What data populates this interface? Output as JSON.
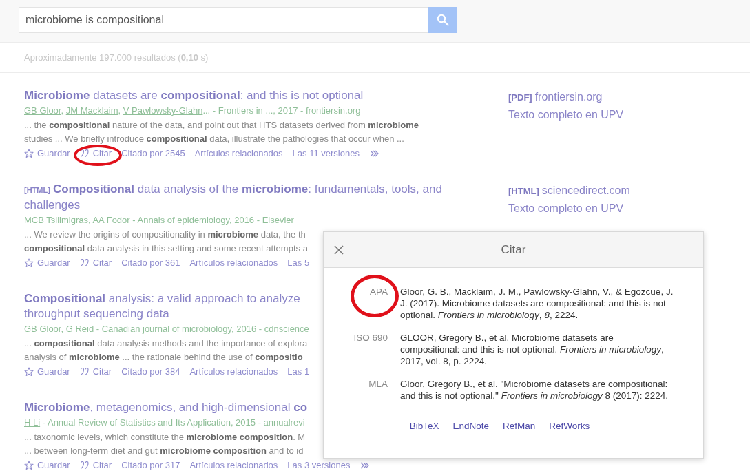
{
  "search": {
    "value": "microbiome is compositional"
  },
  "stats": "Aproximadamente 197.000 resultados (**0,10** s)",
  "results": [
    {
      "title_lines": [
        "**Microbiome** datasets are **compositional**: and this is not optional"
      ],
      "byline": [
        {
          "text": "GB Gloor",
          "link": true
        },
        {
          "text": ", ",
          "link": false
        },
        {
          "text": "JM Macklaim",
          "link": true
        },
        {
          "text": ", ",
          "link": false
        },
        {
          "text": "V Pawlowsky-Glahn",
          "link": true
        },
        {
          "text": "... - Frontiers in ..., 2017 - frontiersin.org",
          "link": false
        }
      ],
      "snippet_lines": [
        "... the **compositional** nature of the data, and point out that HTS datasets derived from **microbiome**",
        "studies ... We briefly introduce **compositional** data, illustrate the pathologies that occur when ..."
      ],
      "actions": [
        {
          "kind": "save",
          "label": "Guardar",
          "highlighted": false
        },
        {
          "kind": "cite",
          "label": "Citar",
          "highlighted": true
        },
        {
          "kind": "link",
          "label": "Citado por 2545",
          "highlighted": false
        },
        {
          "kind": "link",
          "label": "Artículos relacionados",
          "highlighted": false
        },
        {
          "kind": "link",
          "label": "Las 11 versiones",
          "highlighted": false
        },
        {
          "kind": "more",
          "highlighted": false
        }
      ],
      "side": [
        {
          "tag": "[PDF]",
          "text": "frontiersin.org"
        },
        {
          "text": "Texto completo en UPV"
        }
      ]
    },
    {
      "tag": "[HTML]",
      "title_lines": [
        "**Compositional** data analysis of the **microbiome**: fundamentals, tools, and",
        "challenges"
      ],
      "byline": [
        {
          "text": "MCB Tsilimigras",
          "link": true
        },
        {
          "text": ", ",
          "link": false
        },
        {
          "text": "AA Fodor",
          "link": true
        },
        {
          "text": " - Annals of epidemiology, 2016 - Elsevier",
          "link": false
        }
      ],
      "snippet_lines": [
        "... We review the origins of compositionality in **microbiome** data, the th",
        "**compositional** data analysis in this setting and some recent attempts a"
      ],
      "actions": [
        {
          "kind": "save",
          "label": "Guardar",
          "highlighted": false
        },
        {
          "kind": "cite",
          "label": "Citar",
          "highlighted": false
        },
        {
          "kind": "link",
          "label": "Citado por 361",
          "highlighted": false
        },
        {
          "kind": "link",
          "label": "Artículos relacionados",
          "highlighted": false
        },
        {
          "kind": "link",
          "label": "Las 5",
          "highlighted": false
        }
      ],
      "side": [
        {
          "tag": "[HTML]",
          "text": "sciencedirect.com"
        },
        {
          "text": "Texto completo en UPV"
        }
      ]
    },
    {
      "title_lines": [
        "**Compositional** analysis: a valid approach to analyze",
        "throughput sequencing data"
      ],
      "byline": [
        {
          "text": "GB Gloor",
          "link": true
        },
        {
          "text": ", ",
          "link": false
        },
        {
          "text": "G Reid",
          "link": true
        },
        {
          "text": " - Canadian journal of microbiology, 2016 - cdnscience",
          "link": false
        }
      ],
      "snippet_lines": [
        "... **compositional** data analysis methods and the importance of explora",
        "analysis of **microbiome** ... the rationale behind the use of **compositio**"
      ],
      "actions": [
        {
          "kind": "save",
          "label": "Guardar",
          "highlighted": false
        },
        {
          "kind": "cite",
          "label": "Citar",
          "highlighted": false
        },
        {
          "kind": "link",
          "label": "Citado por 384",
          "highlighted": false
        },
        {
          "kind": "link",
          "label": "Artículos relacionados",
          "highlighted": false
        },
        {
          "kind": "link",
          "label": "Las 1",
          "highlighted": false
        }
      ]
    },
    {
      "title_lines": [
        "**Microbiome**, metagenomics, and high-dimensional **co**"
      ],
      "byline": [
        {
          "text": "H Li",
          "link": true
        },
        {
          "text": " - Annual Review of Statistics and Its Application, 2015 - annualrevi",
          "link": false
        }
      ],
      "snippet_lines": [
        "... taxonomic levels, which constitute the **microbiome composition**. M",
        "... between long-term diet and gut **microbiome composition** and to id"
      ],
      "actions": [
        {
          "kind": "save",
          "label": "Guardar",
          "highlighted": false
        },
        {
          "kind": "cite",
          "label": "Citar",
          "highlighted": false
        },
        {
          "kind": "link",
          "label": "Citado por 317",
          "highlighted": false
        },
        {
          "kind": "link",
          "label": "Artículos relacionados",
          "highlighted": false
        },
        {
          "kind": "link",
          "label": "Las 3 versiones",
          "highlighted": false
        },
        {
          "kind": "more",
          "highlighted": false
        }
      ]
    }
  ],
  "cite_dialog": {
    "title": "Citar",
    "citations": [
      {
        "style": "APA",
        "highlighted": true,
        "text": "Gloor, G. B., Macklaim, J. M., Pawlowsky-Glahn, V., & Egozcue, J. J. (2017). Microbiome datasets are compositional: and this is not optional. *Frontiers in microbiology*, *8*, 2224."
      },
      {
        "style": "ISO 690",
        "highlighted": false,
        "text": "GLOOR, Gregory B., et al. Microbiome datasets are compositional: and this is not optional. *Frontiers in microbiology*, 2017, vol. 8, p. 2224."
      },
      {
        "style": "MLA",
        "highlighted": false,
        "text": "Gloor, Gregory B., et al. \"Microbiome datasets are compositional: and this is not optional.\" *Frontiers in microbiology* 8 (2017): 2224."
      }
    ],
    "exports": [
      "BibTeX",
      "EndNote",
      "RefMan",
      "RefWorks"
    ]
  }
}
